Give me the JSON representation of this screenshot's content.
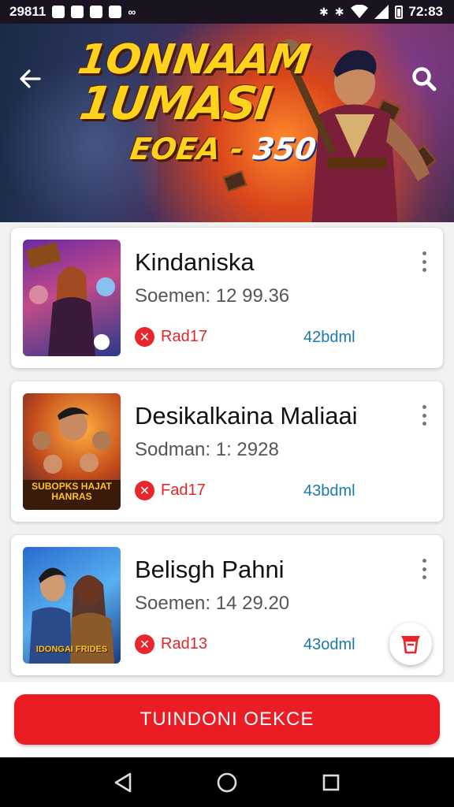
{
  "status_bar": {
    "left_text": "29811",
    "time": "72:83",
    "icons": [
      "sim-icon",
      "image-icon",
      "photo-icon",
      "notification-icon",
      "infinity-icon",
      "bluetooth-icon",
      "bluetooth-icon",
      "wifi-icon",
      "signal-icon",
      "battery-icon"
    ]
  },
  "banner": {
    "title_line1": "1ONNAAM",
    "title_line2": "1UMASI",
    "title_line3_prefix": "EOEA -",
    "title_line3_number": "350",
    "back_icon": "arrow-left-icon",
    "search_icon": "search-icon"
  },
  "items": [
    {
      "name": "Kindaniska",
      "meta": "Soemen: 12 99.36",
      "tag": "Rad17",
      "size": "42bdml"
    },
    {
      "name": "Desikalkaina Maliaai",
      "meta": "Sodman: 1: 2928",
      "tag": "Fad17",
      "size": "43bdml"
    },
    {
      "name": "Belisgh Pahni",
      "meta": "Soemen: 14 29.20",
      "tag": "Rad13",
      "size": "43odml"
    }
  ],
  "thumb_labels": [
    "",
    "SUBOPKS HAJAT HANRAS",
    "IDONGAI FRIDES"
  ],
  "fab_icon": "cart-icon",
  "cta_label": "TUINDONI OEKCE",
  "nav": {
    "back": "nav-back-icon",
    "home": "nav-home-icon",
    "recents": "nav-recents-icon"
  },
  "colors": {
    "accent": "#ec1c24",
    "size_text": "#1a7ab0",
    "title_gold": "#ffd21e"
  }
}
